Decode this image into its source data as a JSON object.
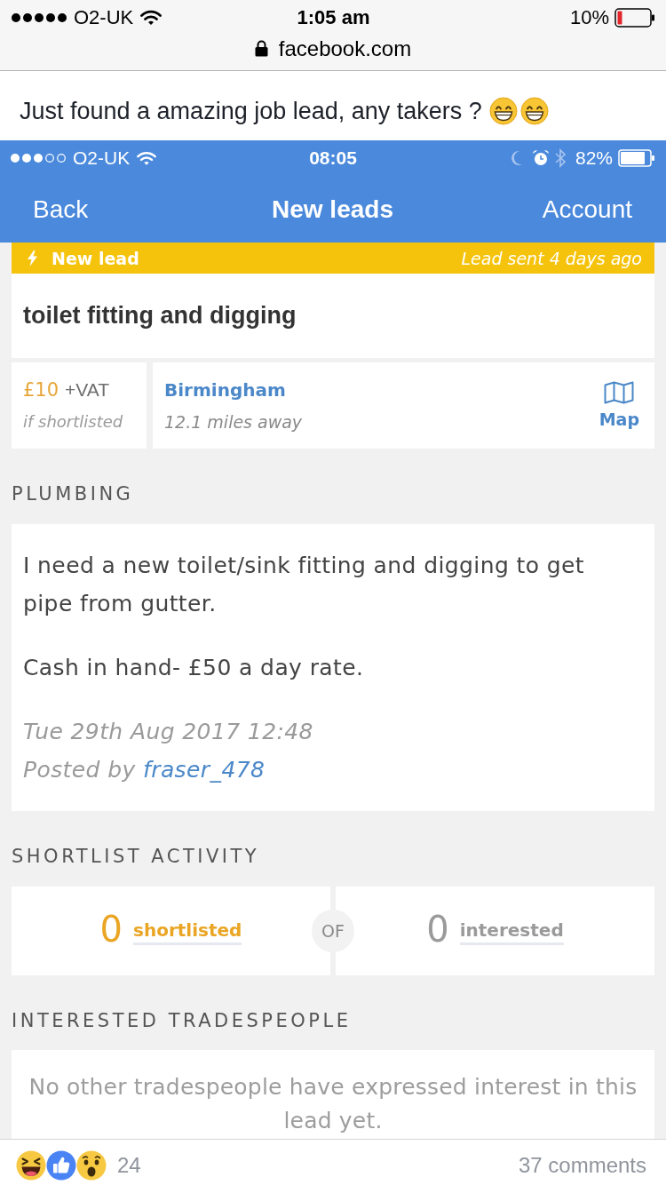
{
  "status_bar": {
    "carrier": "O2-UK",
    "time": "1:05 am",
    "battery": "10%"
  },
  "address_bar": {
    "url": "facebook.com"
  },
  "post": {
    "text": "Just found a amazing job lead, any takers ?"
  },
  "app_screenshot": {
    "status_bar": {
      "carrier": "O2-UK",
      "time": "08:05",
      "battery": "82%"
    },
    "nav_bar": {
      "back": "Back",
      "title": "New leads",
      "account": "Account"
    },
    "banner": {
      "label": "New lead",
      "sent": "Lead sent 4 days ago"
    },
    "lead": {
      "title": "toilet fitting and digging",
      "price": "£10",
      "vat": "+VAT",
      "price_note": "if shortlisted",
      "location": "Birmingham",
      "distance": "12.1 miles away",
      "map": "Map"
    },
    "category": "PLUMBING",
    "description": {
      "paragraphs": [
        "I need a new toilet/sink fitting and digging to get pipe from gutter.",
        "Cash in hand- £50 a day rate."
      ],
      "date": "Tue 29th Aug 2017 12:48",
      "posted_by": "Posted by",
      "author": "fraser_478"
    },
    "shortlist_activity": {
      "heading": "SHORTLIST ACTIVITY",
      "shortlisted": {
        "count": "0",
        "label": "shortlisted"
      },
      "separator": "OF",
      "interested": {
        "count": "0",
        "label": "interested"
      }
    },
    "interested_tradespeople": {
      "heading": "INTERESTED TRADESPEOPLE",
      "message": "No other tradespeople have expressed interest in this lead yet."
    }
  },
  "footer": {
    "reactions": "24",
    "comments": "37 comments"
  }
}
